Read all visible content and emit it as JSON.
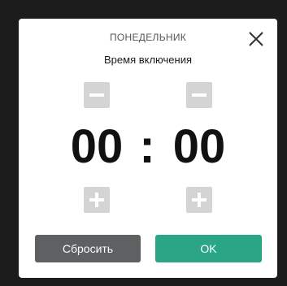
{
  "dialog": {
    "day": "ПОНЕДЕЛЬНИК",
    "subtitle": "Время включения",
    "time": {
      "hours": "00",
      "separator": ":",
      "minutes": "00"
    },
    "buttons": {
      "reset": "Сбросить",
      "ok": "OK"
    }
  },
  "colors": {
    "backdrop": "#1c1c1c",
    "stepper": "#d4d4d4",
    "reset_button": "#5f6062",
    "ok_button": "#2aa586"
  },
  "icons": {
    "close": "close-icon",
    "decrement": "minus-icon",
    "increment": "plus-icon"
  }
}
